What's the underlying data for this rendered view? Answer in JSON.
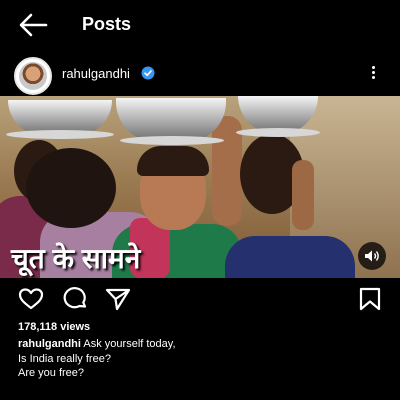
{
  "header": {
    "title": "Posts"
  },
  "post": {
    "username": "rahulgandhi",
    "media_caption": "चूत के सामने",
    "views": "178,118 views",
    "caption_user": "rahulgandhi",
    "caption_lines": [
      "Ask yourself today,",
      "Is India really free?",
      "Are you free?"
    ]
  },
  "icons": {
    "back": "back-arrow-icon",
    "verified": "verified-badge-icon",
    "more": "more-options-icon",
    "sound": "sound-icon",
    "like": "heart-icon",
    "comment": "comment-icon",
    "share": "share-icon",
    "save": "bookmark-icon"
  },
  "colors": {
    "background": "#000000",
    "text": "#ffffff",
    "verified": "#3897f0"
  }
}
